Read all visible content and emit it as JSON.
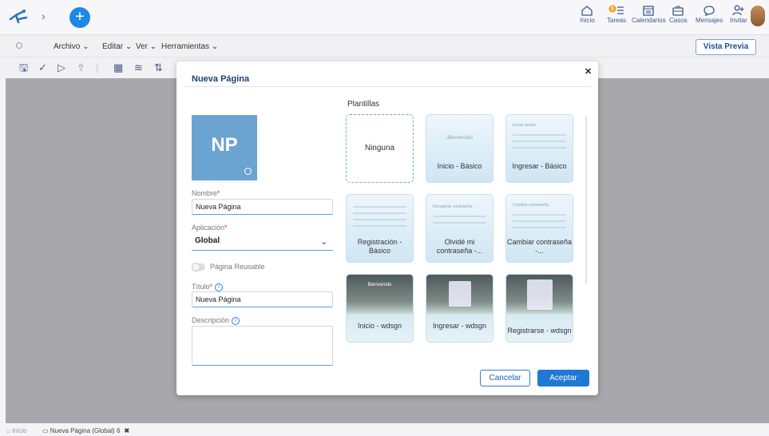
{
  "topbar": {
    "items": [
      {
        "label": "Inicio",
        "icon": "home-icon"
      },
      {
        "label": "Tareas",
        "icon": "tasks-icon",
        "badge": "5"
      },
      {
        "label": "Calendarios",
        "icon": "calendar-icon"
      },
      {
        "label": "Casos",
        "icon": "briefcase-icon"
      },
      {
        "label": "Mensajes",
        "icon": "chat-icon"
      },
      {
        "label": "Invitar",
        "icon": "add-user-icon"
      }
    ]
  },
  "menubar": {
    "archivo": "Archivo ⌄",
    "editar": "Editar ⌄",
    "ver": "Ver ⌄",
    "herramientas": "Herramientas ⌄",
    "vista_previa": "Vista Previa"
  },
  "modal": {
    "title": "Nueva Página",
    "avatar_text": "NP",
    "nombre_label": "Nombre",
    "nombre_value": "Nueva Página",
    "aplicacion_label": "Aplicación",
    "aplicacion_value": "Global",
    "reusable_label": "Página Reusable",
    "titulo_label": "Título",
    "titulo_value": "Nueva Página",
    "descripcion_label": "Descripción",
    "plantillas_label": "Plantillas",
    "templates": [
      {
        "label": "Ninguna"
      },
      {
        "label": "Inicio - Básico",
        "preview": "¡Bienvenido!"
      },
      {
        "label": "Ingresar - Básico",
        "preview": "Iniciar sesión"
      },
      {
        "label": "Registración - Básico"
      },
      {
        "label": "Olvidé mi contraseña -...",
        "preview": "Recuperar contraseña"
      },
      {
        "label": "Cambiar contraseña -...",
        "preview": "Cambiar contraseña"
      },
      {
        "label": "Inicio - wdsgn",
        "preview": "Bienvenido"
      },
      {
        "label": "Ingresar - wdsgn"
      },
      {
        "label": "Registrarse - wdsgn"
      }
    ],
    "cancel": "Cancelar",
    "accept": "Aceptar"
  },
  "bottom": {
    "home": "Inicio",
    "tab": "Nueva Página (Global) 6"
  }
}
